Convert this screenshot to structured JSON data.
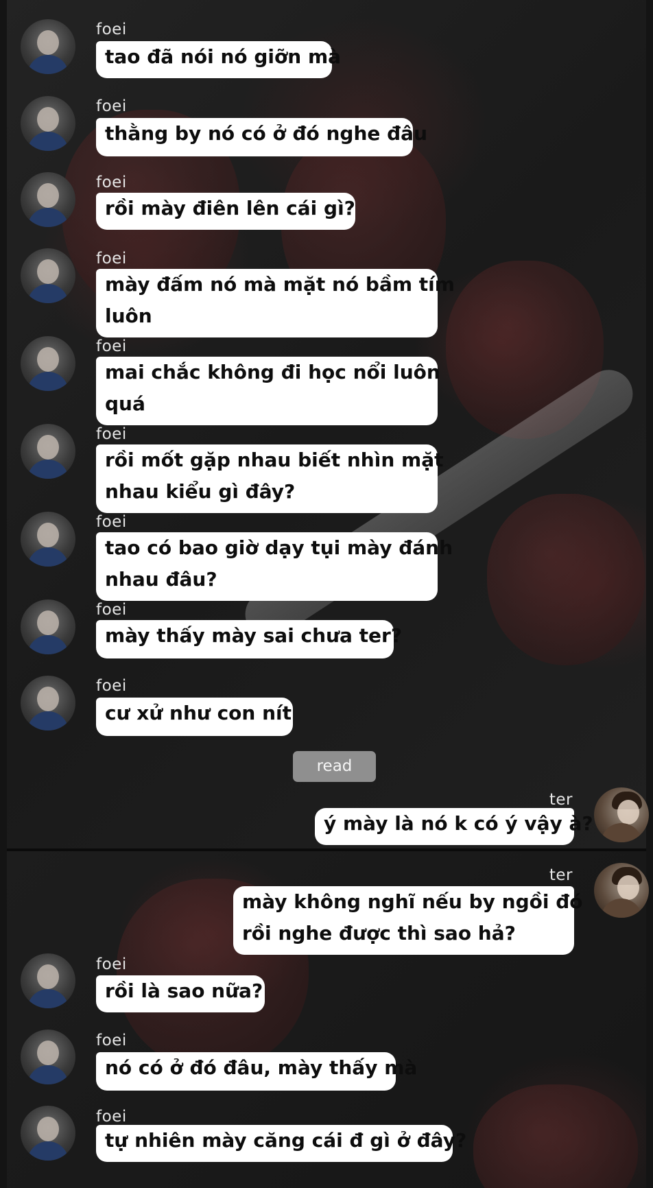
{
  "chat": {
    "contacts": {
      "foei": {
        "name": "foei",
        "avatar_icon": "foei-avatar"
      },
      "ter": {
        "name": "ter",
        "avatar_icon": "ter-avatar"
      }
    },
    "read_receipt": "read",
    "messages": [
      {
        "sender": "foei",
        "lines": [
          "tao đã nói nó giỡn mà"
        ]
      },
      {
        "sender": "foei",
        "lines": [
          "thằng by nó có ở đó nghe đâu"
        ]
      },
      {
        "sender": "foei",
        "lines": [
          "rồi mày điên lên cái gì?"
        ]
      },
      {
        "sender": "foei",
        "lines": [
          "mày đấm nó mà mặt nó bầm tím",
          "luôn"
        ]
      },
      {
        "sender": "foei",
        "lines": [
          "mai chắc không đi học nổi luôn",
          "quá"
        ]
      },
      {
        "sender": "foei",
        "lines": [
          "rồi mốt gặp nhau biết nhìn mặt",
          "nhau kiểu gì đây?"
        ]
      },
      {
        "sender": "foei",
        "lines": [
          "tao có bao giờ dạy tụi mày đánh",
          "nhau đâu?"
        ]
      },
      {
        "sender": "foei",
        "lines": [
          "mày thấy mày sai chưa ter?"
        ]
      },
      {
        "sender": "foei",
        "lines": [
          "cư xử như con nít"
        ]
      },
      {
        "sender": "ter",
        "lines": [
          "ý mày là nó k có ý vậy à?"
        ]
      },
      {
        "sender": "ter",
        "lines": [
          "mày không nghĩ nếu by ngồi đó",
          "rồi nghe được thì sao hả?"
        ]
      },
      {
        "sender": "foei",
        "lines": [
          "rồi là sao nữa?"
        ]
      },
      {
        "sender": "foei",
        "lines": [
          "nó có ở đó đâu, mày thấy mà"
        ]
      },
      {
        "sender": "foei",
        "lines": [
          "tự nhiên mày căng cái đ gì ở đây?"
        ]
      }
    ]
  }
}
